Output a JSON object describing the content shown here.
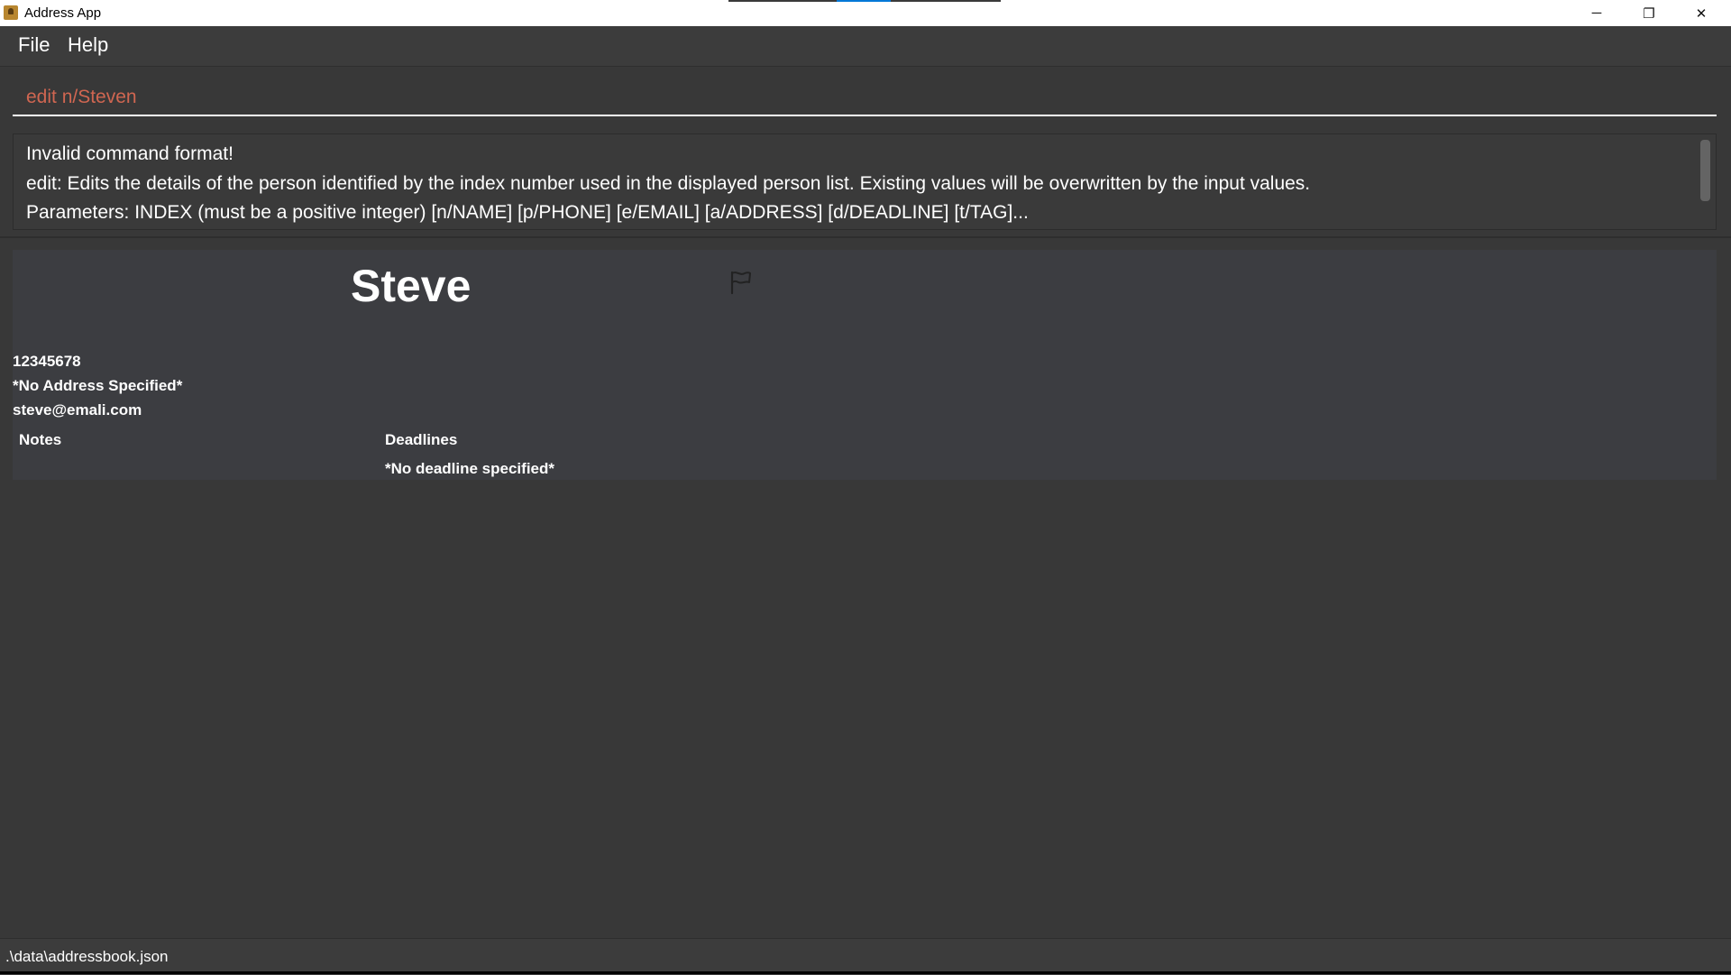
{
  "window": {
    "title": "Address App",
    "icon": "address-book-icon",
    "controls": {
      "minimize": "─",
      "restore": "❐",
      "close": "✕"
    }
  },
  "menu": {
    "items": [
      {
        "label": "File"
      },
      {
        "label": "Help"
      }
    ]
  },
  "command": {
    "value": "edit n/Steven",
    "text_color": "#d06651"
  },
  "result": {
    "lines": [
      "Invalid command format!",
      "edit: Edits the details of the person identified by the index number used in the displayed person list. Existing values will be overwritten by the input values.",
      "Parameters: INDEX (must be a positive integer) [n/NAME] [p/PHONE] [e/EMAIL] [a/ADDRESS] [d/DEADLINE] [t/TAG]..."
    ]
  },
  "person": {
    "name": "Steve",
    "flag_icon": "flag-icon",
    "phone": "12345678",
    "address": "*No Address Specified*",
    "email": "steve@emali.com",
    "notes_header": "Notes",
    "deadlines_header": "Deadlines",
    "deadline_value": "*No deadline specified*"
  },
  "status": {
    "path": ".\\data\\addressbook.json"
  },
  "colors": {
    "background": "#383838",
    "card": "#3c3d41",
    "titlebar": "#ffffff",
    "accent": "#0078d7"
  }
}
